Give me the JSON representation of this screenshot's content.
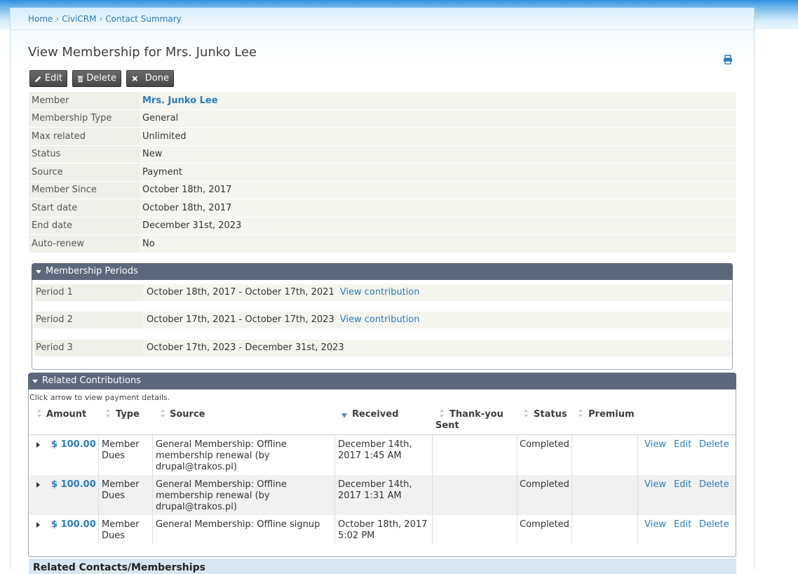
{
  "breadcrumb": [
    "Home",
    "CiviCRM",
    "Contact Summary"
  ],
  "page_title": "View Membership for Mrs. Junko Lee",
  "actions": {
    "edit": "Edit",
    "delete": "Delete",
    "done": "Done"
  },
  "details": [
    {
      "label": "Member",
      "value": "Mrs. Junko Lee"
    },
    {
      "label": "Membership Type",
      "value": "General"
    },
    {
      "label": "Max related",
      "value": "Unlimited"
    },
    {
      "label": "Status",
      "value": "New"
    },
    {
      "label": "Source",
      "value": "Payment"
    },
    {
      "label": "Member Since",
      "value": "October 18th, 2017"
    },
    {
      "label": "Start date",
      "value": "October 18th, 2017"
    },
    {
      "label": "End date",
      "value": "December 31st, 2023"
    },
    {
      "label": "Auto-renew",
      "value": "No"
    }
  ],
  "periods": {
    "title": "Membership Periods",
    "rows": [
      {
        "label": "Period 1",
        "range": "October 18th, 2017 - October 17th, 2021",
        "link": "View contribution"
      },
      {
        "label": "Period 2",
        "range": "October 17th, 2021 - October 17th, 2023",
        "link": "View contribution"
      },
      {
        "label": "Period 3",
        "range": "October 17th, 2023 - December 31st, 2023",
        "link": ""
      }
    ]
  },
  "contributions": {
    "title": "Related Contributions",
    "hint": "Click arrow to view payment details.",
    "columns": [
      "Amount",
      "Type",
      "Source",
      "Received",
      "Thank-you Sent",
      "Status",
      "Premium"
    ],
    "rows": [
      {
        "amount": "$ 100.00",
        "type_line1": "Member",
        "type_line2": "Dues",
        "source_lines": [
          "General Membership: Offline",
          "membership renewal (by",
          "drupal@trakos.pl)"
        ],
        "received_lines": [
          "December 14th,",
          "2017 1:45 AM"
        ],
        "thankyou": "",
        "status": "Completed",
        "premium": "",
        "links": [
          "View",
          "Edit",
          "Delete"
        ]
      },
      {
        "amount": "$ 100.00",
        "type_line1": "Member",
        "type_line2": "Dues",
        "source_lines": [
          "General Membership: Offline",
          "membership renewal (by",
          "drupal@trakos.pl)"
        ],
        "received_lines": [
          "December 14th,",
          "2017 1:31 AM"
        ],
        "thankyou": "",
        "status": "Completed",
        "premium": "",
        "links": [
          "View",
          "Edit",
          "Delete"
        ]
      },
      {
        "amount": "$ 100.00",
        "type_line1": "Member",
        "type_line2": "Dues",
        "source_lines": [
          "General Membership: Offline signup"
        ],
        "received_lines": [
          "October 18th, 2017",
          "5:02 PM"
        ],
        "thankyou": "",
        "status": "Completed",
        "premium": "",
        "links": [
          "View",
          "Edit",
          "Delete"
        ]
      }
    ]
  },
  "next_section": "Related Contacts/Memberships"
}
